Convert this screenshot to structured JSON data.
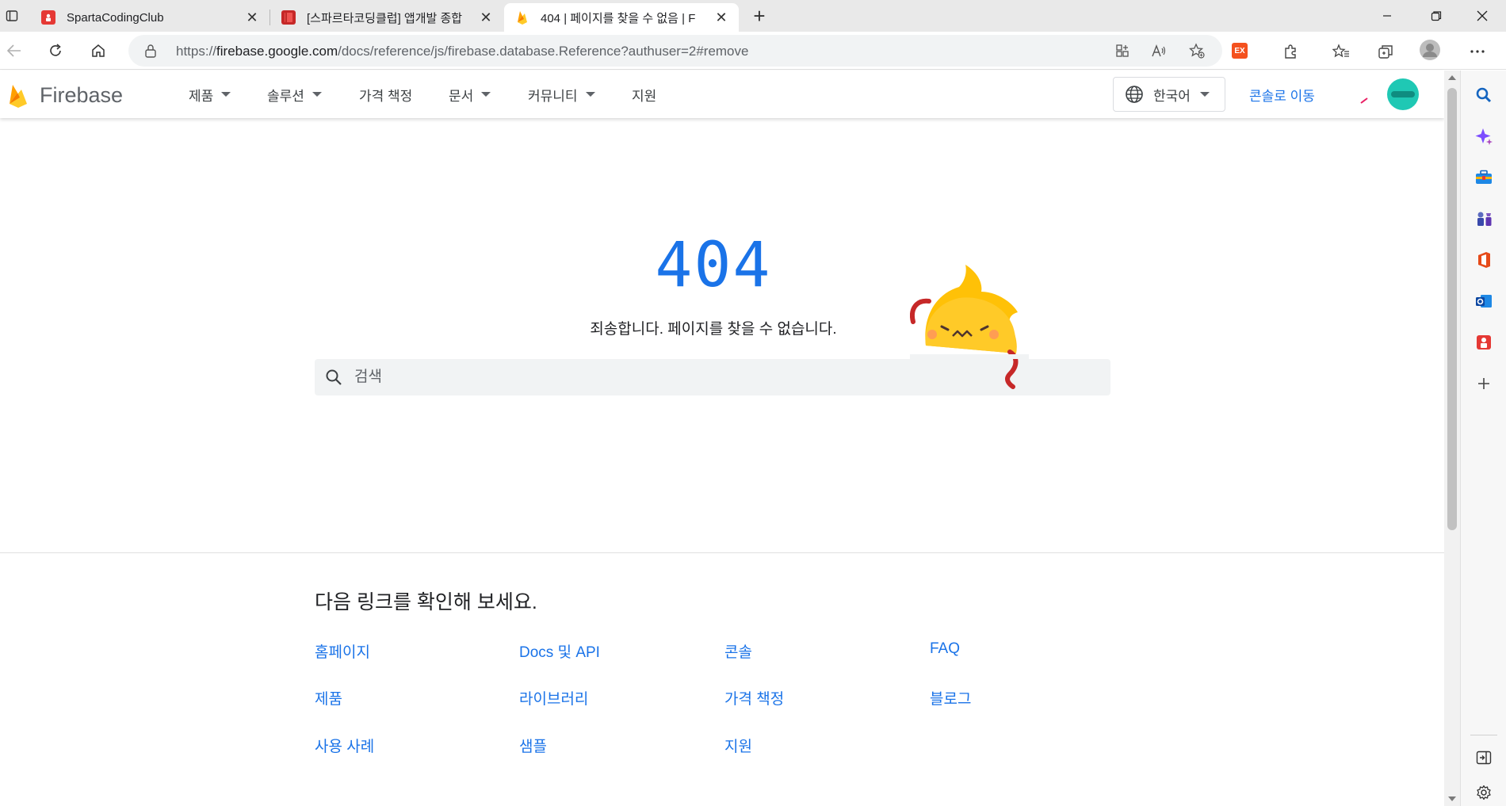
{
  "browser": {
    "tabs": [
      {
        "title": "SpartaCodingClub",
        "favicon": "sparta-favicon",
        "active": false
      },
      {
        "title": "[스파르타코딩클럽] 앱개발 종합",
        "favicon": "notebook-favicon",
        "active": false
      },
      {
        "title": "404 | 페이지를 찾을 수 없음 | F",
        "favicon": "firebase-favicon",
        "active": true
      }
    ],
    "new_tab": "+",
    "address": {
      "scheme": "https://",
      "host": "firebase.google.com",
      "path": "/docs/reference/js/firebase.database.Reference?authuser=2#remove"
    },
    "extension_badge": "EX"
  },
  "header": {
    "brand": "Firebase",
    "nav": [
      {
        "label": "제품",
        "dropdown": true
      },
      {
        "label": "솔루션",
        "dropdown": true
      },
      {
        "label": "가격 책정",
        "dropdown": false
      },
      {
        "label": "문서",
        "dropdown": true
      },
      {
        "label": "커뮤니티",
        "dropdown": true
      },
      {
        "label": "지원",
        "dropdown": false
      }
    ],
    "language": "한국어",
    "console_link": "콘솔로 이동"
  },
  "error": {
    "code": "404",
    "message": "죄송합니다. 페이지를 찾을 수 없습니다.",
    "search_placeholder": "검색"
  },
  "links_section": {
    "heading": "다음 링크를 확인해 보세요.",
    "columns": [
      [
        "홈페이지",
        "제품",
        "사용 사례"
      ],
      [
        "Docs 및 API",
        "라이브러리",
        "샘플"
      ],
      [
        "콘솔",
        "가격 책정",
        "지원"
      ],
      [
        "FAQ",
        "블로그"
      ]
    ]
  },
  "colors": {
    "link_blue": "#1a73e8",
    "firebase_yellow": "#ffca28",
    "firebase_orange": "#f57c00",
    "avatar_teal": "#1fc8b4"
  }
}
